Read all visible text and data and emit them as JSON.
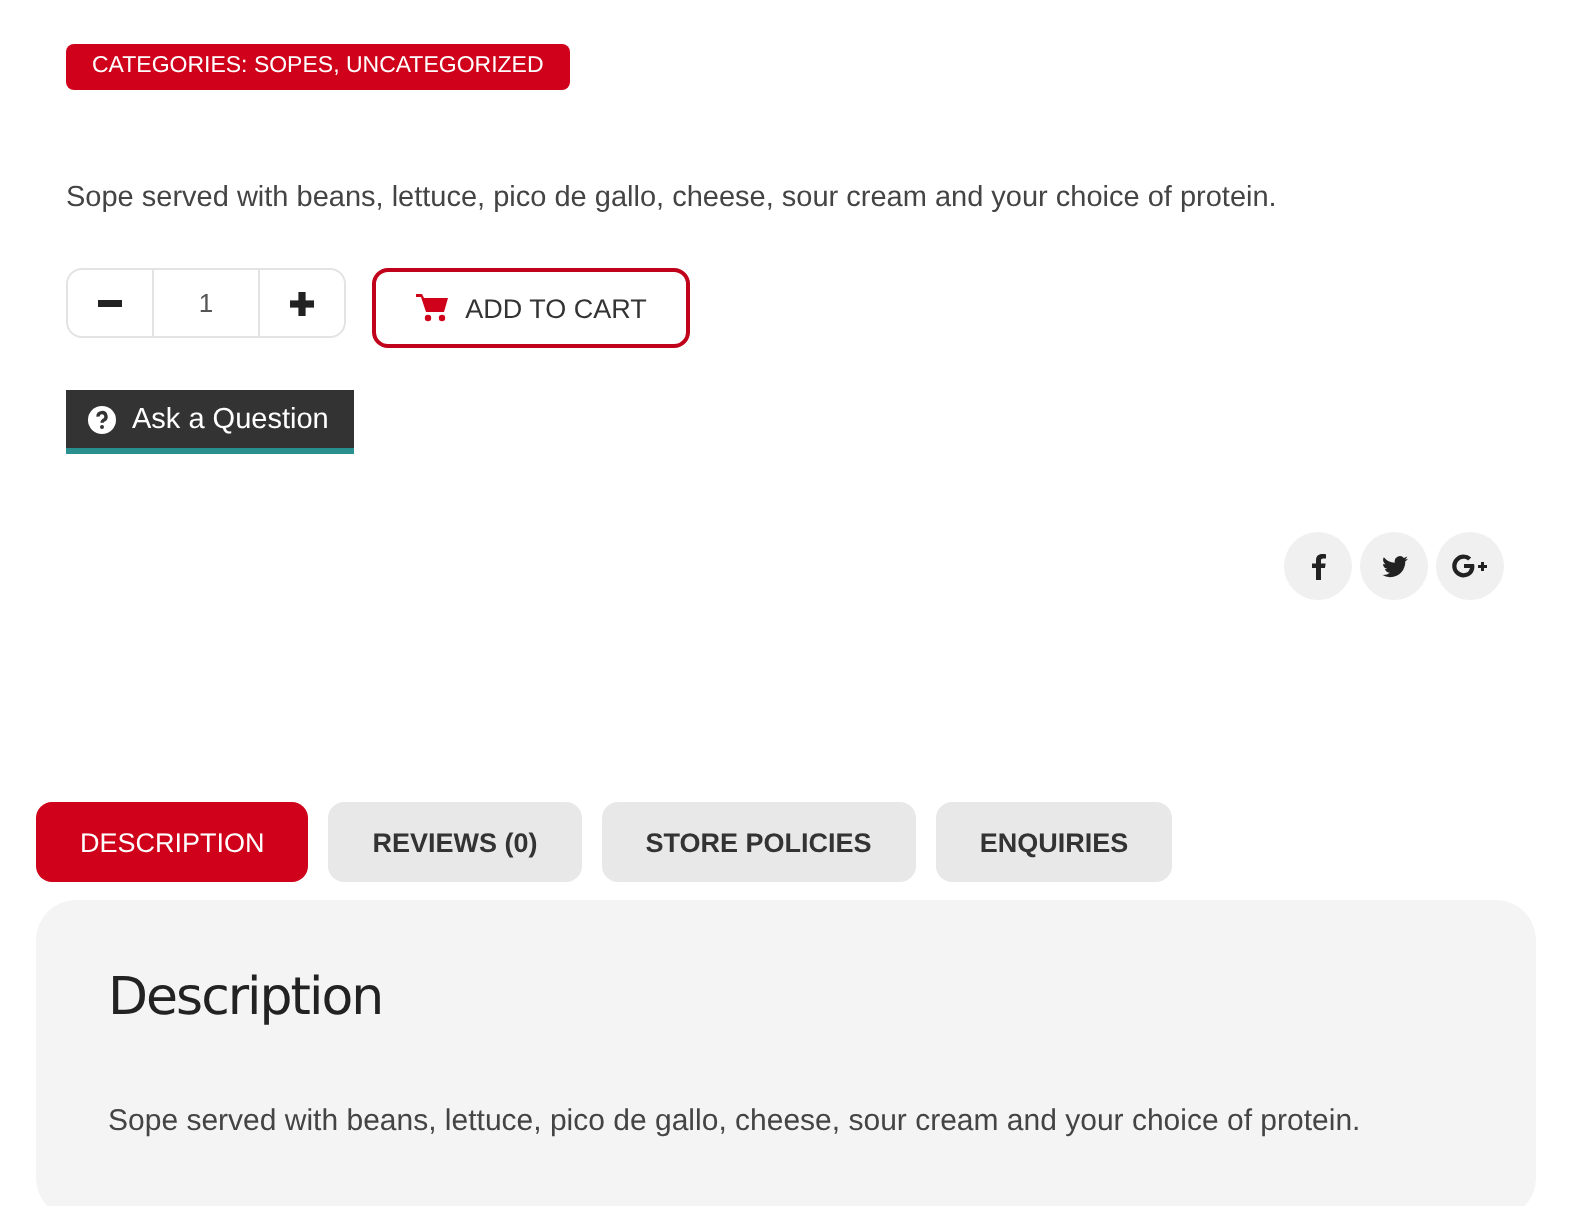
{
  "product": {
    "categories": "CATEGORIES: SOPES, UNCATEGORIZED",
    "summary": "Sope served with beans, lettuce, pico de gallo, cheese, sour cream and your choice of protein."
  },
  "quantity": {
    "value": "1"
  },
  "add_to_cart": "ADD TO CART",
  "ask_question": "Ask a Question",
  "social": [
    {
      "kind": "facebook"
    },
    {
      "kind": "twitter"
    },
    {
      "kind": "google-plus"
    }
  ],
  "tabs": [
    {
      "label": "DESCRIPTION",
      "selected": true
    },
    {
      "label": "REVIEWS (0)",
      "selected": false
    },
    {
      "label": "STORE POLICIES",
      "selected": false
    },
    {
      "label": "ENQUIRIES",
      "selected": false
    }
  ],
  "panel": {
    "heading": "Description",
    "text": "Sope served with beans, lettuce, pico de gallo, cheese, sour cream and your choice of protein."
  }
}
